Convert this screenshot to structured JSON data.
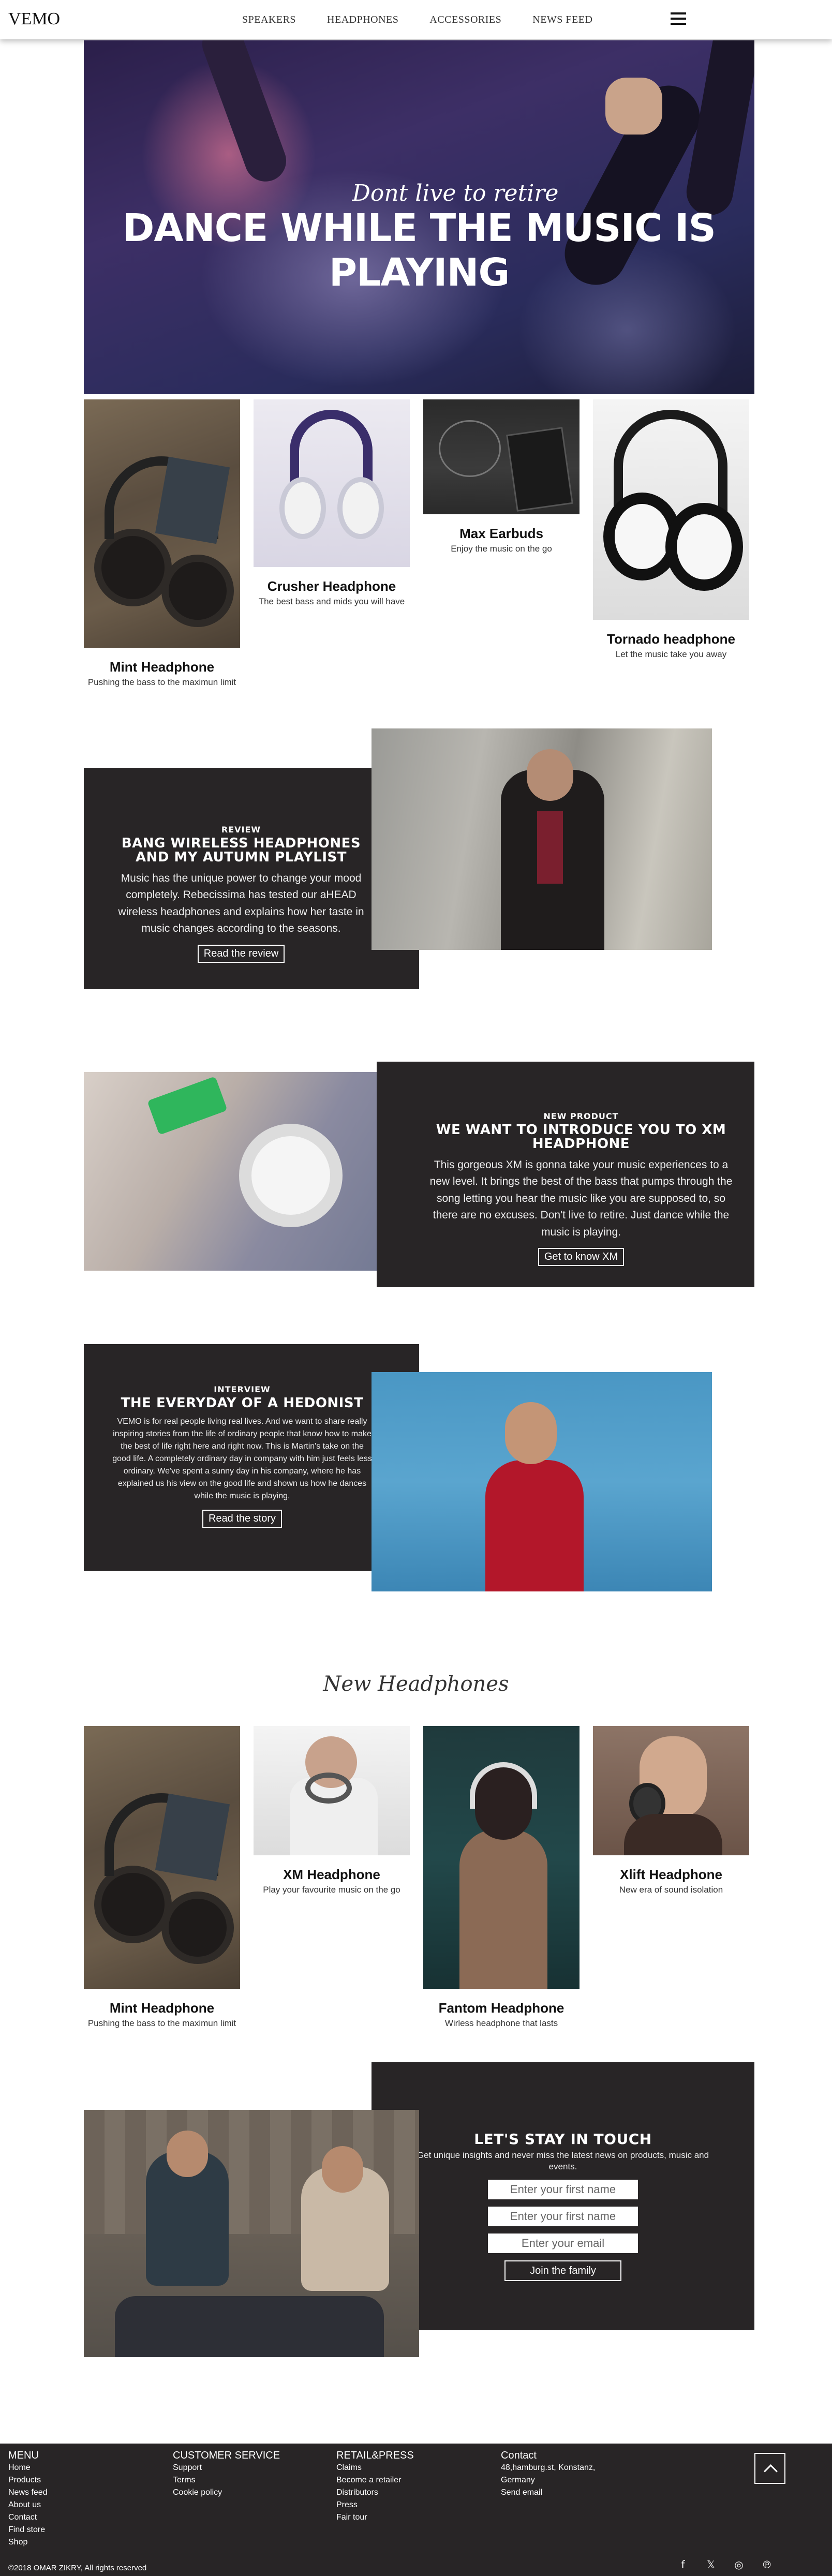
{
  "nav": {
    "logo": "VEMO",
    "links": [
      "SPEAKERS",
      "HEADPHONES",
      "ACCESSORIES",
      "NEWS FEED"
    ],
    "menu_icon": "hamburger-icon"
  },
  "hero": {
    "subtitle": "Dont live to retire",
    "title": "DANCE WHILE THE MUSIC IS PLAYING"
  },
  "products": [
    {
      "name": "Mint Headphone",
      "desc": "Pushing the bass to the maximun limit"
    },
    {
      "name": "Crusher Headphone",
      "desc": "The best bass and mids you will have"
    },
    {
      "name": "Max Earbuds",
      "desc": "Enjoy the music on the go"
    },
    {
      "name": "Tornado headphone",
      "desc": "Let the music take you away"
    }
  ],
  "review": {
    "eyebrow": "REVIEW",
    "title": "BANG WIRELESS HEADPHONES AND MY AUTUMN PLAYLIST",
    "body": "Music has the unique power to change your mood completely. Rebecissima has tested our aHEAD wireless headphones and explains how her taste in music changes according to the seasons.",
    "button": "Read the review"
  },
  "new_product": {
    "eyebrow": "NEW PRODUCT",
    "title": "WE WANT TO INTRODUCE YOU TO XM HEADPHONE",
    "body": "This gorgeous XM is gonna take your music experiences to a new level. It brings the best of the bass that pumps through the song letting you hear the music like you are supposed to, so there are no excuses. Don't live to retire. Just dance while the music is playing.",
    "button": "Get to know XM"
  },
  "interview": {
    "eyebrow": "INTERVIEW",
    "title": "THE EVERYDAY OF A HEDONIST",
    "body": "VEMO is for real people living real lives. And we want to share really inspiring stories from the life of ordinary people that know how to make the best of life right here and right now. This is Martin's take on the good life. A completely ordinary day in company with him just feels less ordinary. We've spent a sunny day in his company, where he has explained us his view on the good life and shown us how he dances while the music is playing.",
    "button": "Read the story"
  },
  "new_headphones": {
    "heading": "New Headphones",
    "items": [
      {
        "name": "Mint Headphone",
        "desc": "Pushing the bass to the maximun limit"
      },
      {
        "name": "XM Headphone",
        "desc": "Play your favourite music on the go"
      },
      {
        "name": "Fantom Headphone",
        "desc": "Wirless headphone that lasts"
      },
      {
        "name": "Xlift Headphone",
        "desc": "New era of sound isolation"
      }
    ]
  },
  "newsletter": {
    "title": "LET'S STAY IN TOUCH",
    "subtitle": "Get unique insights and never miss the latest news on products, music and events.",
    "first_placeholder": "Enter your first name",
    "second_placeholder": "Enter your first name",
    "email_placeholder": "Enter your email",
    "button": "Join the family"
  },
  "footer": {
    "menu": {
      "heading": "MENU",
      "links": [
        "Home",
        "Products",
        "News feed",
        "About us",
        "Contact",
        "Find store",
        "Shop"
      ]
    },
    "customer": {
      "heading": "CUSTOMER SERVICE",
      "links": [
        "Support",
        "Terms",
        "Cookie policy"
      ]
    },
    "retail": {
      "heading": "RETAIL&PRESS",
      "links": [
        "Claims",
        "Become a retailer",
        "Distributors",
        "Press",
        "Fair tour"
      ]
    },
    "contact": {
      "heading": "Contact",
      "lines": [
        "48,hamburg.st, Konstanz,",
        "Germany"
      ],
      "link": "Send email"
    },
    "copyright": "©2018 OMAR ZIKRY, All rights reserved",
    "social_icons": [
      "facebook-icon",
      "twitter-icon",
      "instagram-icon",
      "pinterest-icon"
    ]
  }
}
